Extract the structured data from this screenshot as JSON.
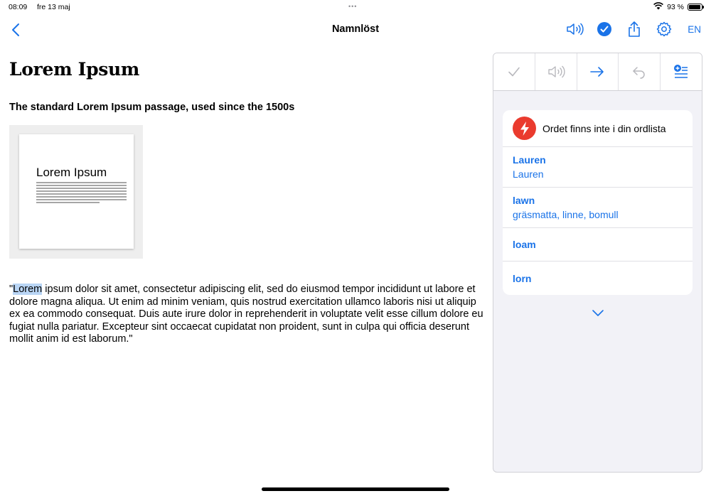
{
  "status": {
    "time": "08:09",
    "date": "fre 13 maj",
    "dots": "•••",
    "battery_text": "93 %",
    "battery_level": 0.93
  },
  "nav": {
    "title": "Namnlöst",
    "language": "EN",
    "icons": [
      "chevron-left-icon",
      "speaker-icon",
      "checkmark-circle-icon",
      "share-icon",
      "gear-icon"
    ]
  },
  "document": {
    "title": "Lorem Ipsum",
    "subtitle": "The standard Lorem Ipsum passage, used since the 1500s",
    "thumbnail_title": "Lorem Ipsum",
    "body_prefix": "\"",
    "body_highlight": "Lorem",
    "body_rest": " ipsum dolor sit amet, consectetur adipiscing elit, sed do eiusmod tempor incididunt ut labore et dolore magna aliqua. Ut enim ad minim veniam, quis nostrud exercitation ullamco laboris nisi ut aliquip ex ea commodo consequat. Duis aute irure dolor in reprehenderit in voluptate velit esse cillum dolore eu fugiat nulla pariatur. Excepteur sint occaecat cupidatat non proident, sunt in culpa qui officia deserunt mollit anim id est laborum.\""
  },
  "panel": {
    "toolbar": [
      "checkmark-icon",
      "speaker-icon",
      "arrow-right-icon",
      "undo-icon",
      "add-to-list-icon"
    ],
    "header": "Ordet finns inte i din ordlista",
    "suggestions": [
      {
        "word": "Lauren",
        "translation": "Lauren"
      },
      {
        "word": "lawn",
        "translation": "gräsmatta, linne, bomull"
      },
      {
        "word": "loam",
        "translation": ""
      },
      {
        "word": "lorn",
        "translation": ""
      }
    ]
  },
  "colors": {
    "accent": "#1a73e8",
    "warning": "#ea3b2e",
    "highlight": "#b9d5f5",
    "panel_bg": "#f2f2f7"
  }
}
